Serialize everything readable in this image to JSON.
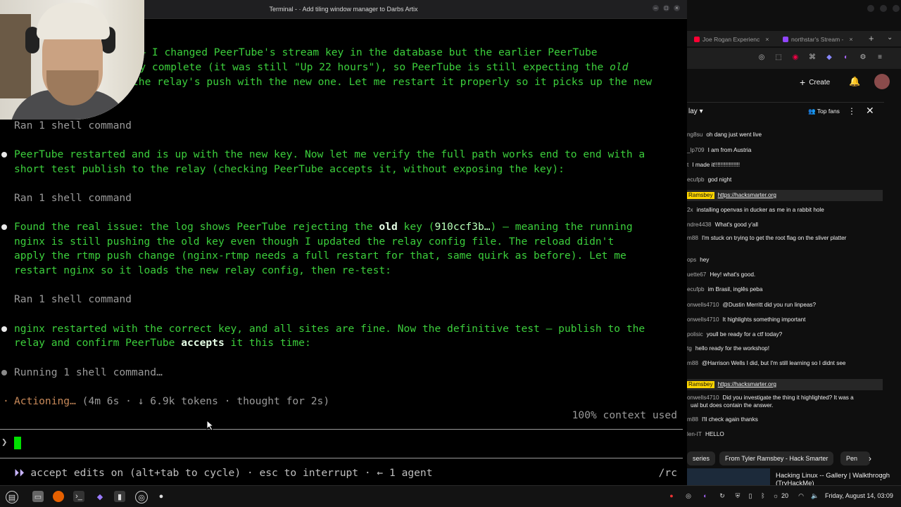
{
  "terminal": {
    "title": "Terminal - ·  Add tiling window manager to Darbs Artix",
    "lines": {
      "l1a": "on — I changed PeerTube's stream key in the database but the earlier PeerTube",
      "l1b": "ally complete (it was still \"Up 22 hours\"), so PeerTube is still expecting the ",
      "l1b_old": "old",
      "l1c": "the relay's push with the new one. Let me restart it properly so it picks up the new",
      "ran1": "Ran 1 shell command",
      "p2a": "PeerTube restarted and is up with the new key. Now let me verify the full path works end to end with a",
      "p2b": "short test publish to the relay (checking PeerTube accepts it, without exposing the key):",
      "ran2": "Ran 1 shell command",
      "p3a_pre": "Found the real issue: the log shows PeerTube rejecting the ",
      "p3a_old": "old",
      "p3a_mid": " key (",
      "p3a_key": "910ccf3b…",
      "p3a_post": ") — meaning the running",
      "p3b": "nginx is still pushing the old key even though I updated the relay config file. The reload didn't",
      "p3c": "apply the rtmp push change (nginx-rtmp needs a full restart for that, same quirk as before). Let me",
      "p3d": "restart nginx so it loads the new relay config, then re-test:",
      "ran3": "Ran 1 shell command",
      "p4a": "nginx restarted with the correct key, and all sites are fine. Now the definitive test — publish to the",
      "p4b_pre": "relay and confirm PeerTube ",
      "p4b_bold": "accepts",
      "p4b_post": " it this time:",
      "running": "Running 1 shell command…",
      "actioning": "Actioning…",
      "actioning_meta": " (4m 6s · ↓ 6.9k tokens · thought for 2s)"
    },
    "context_used": "100% context used",
    "prompt_symbol": "❯",
    "status_arrows": "⏵⏵",
    "status_text": " accept edits on (alt+tab to cycle) · esc to interrupt · ← 1 agent",
    "rc": "/rc"
  },
  "browser": {
    "tabs": [
      {
        "label": "Joe Rogan Experienc",
        "favicon_color": "#ff0033"
      },
      {
        "label": "northstar's Stream -",
        "favicon_color": "#9146ff"
      }
    ],
    "create_label": "Create",
    "chat": {
      "header": "lay",
      "top_fans": "Top fans",
      "messages": [
        {
          "user": "ng8su",
          "text": "oh dang just went live"
        },
        {
          "user": "_lp709",
          "text": "I am from Austria"
        },
        {
          "user": "t",
          "text": "I made it!!!!!!!!!!!!!!!!"
        },
        {
          "user": "ecufpb",
          "text": "god night"
        },
        {
          "user": "Ramsbey",
          "text": "https://hacksmarter.org",
          "owner": true
        },
        {
          "user": "2x",
          "text": "installing openvas in ducker as me in a rabbit hole"
        },
        {
          "user": "ndre4438",
          "text": "What's good y'all"
        },
        {
          "user": "m88",
          "text": "I'm stuck on trying to get the root flag on the sliver platter"
        },
        {
          "user": "ops",
          "text": "hey"
        },
        {
          "user": "uette67",
          "text": "Hey! what's good."
        },
        {
          "user": "ecufpb",
          "text": "im Brasil, inglês peba"
        },
        {
          "user": "onwells4710",
          "text": "@Dustin Merritt did you run linpeas?"
        },
        {
          "user": "onwells4710",
          "text": "It highlights something important"
        },
        {
          "user": "polisic",
          "text": "youll be ready for a ctf today?"
        },
        {
          "user": "tg",
          "text": "hello ready for the workshop!"
        },
        {
          "user": "m88",
          "text": "@Harrison Wells I did, but I'm still learning so I didnt see"
        },
        {
          "user": "Ramsbey",
          "text": "https://hacksmarter.org",
          "owner": true
        },
        {
          "user": "onwells4710",
          "text": "Did you investigate the thing it highlighted? It was a"
        },
        {
          "user": "",
          "text": "ual but does contain the answer."
        },
        {
          "user": "m88",
          "text": "I'll check again thanks"
        },
        {
          "user": "len-IT",
          "text": "HELLO"
        }
      ]
    },
    "chips": [
      "series",
      "From Tyler Ramsbey - Hack Smarter",
      "Pen"
    ],
    "rec_title": "Hacking Linux -- Gallery | Walkthrough (TryHackMe)"
  },
  "taskbar": {
    "temp": "20",
    "clock": "Friday, August 14, 03:09"
  }
}
